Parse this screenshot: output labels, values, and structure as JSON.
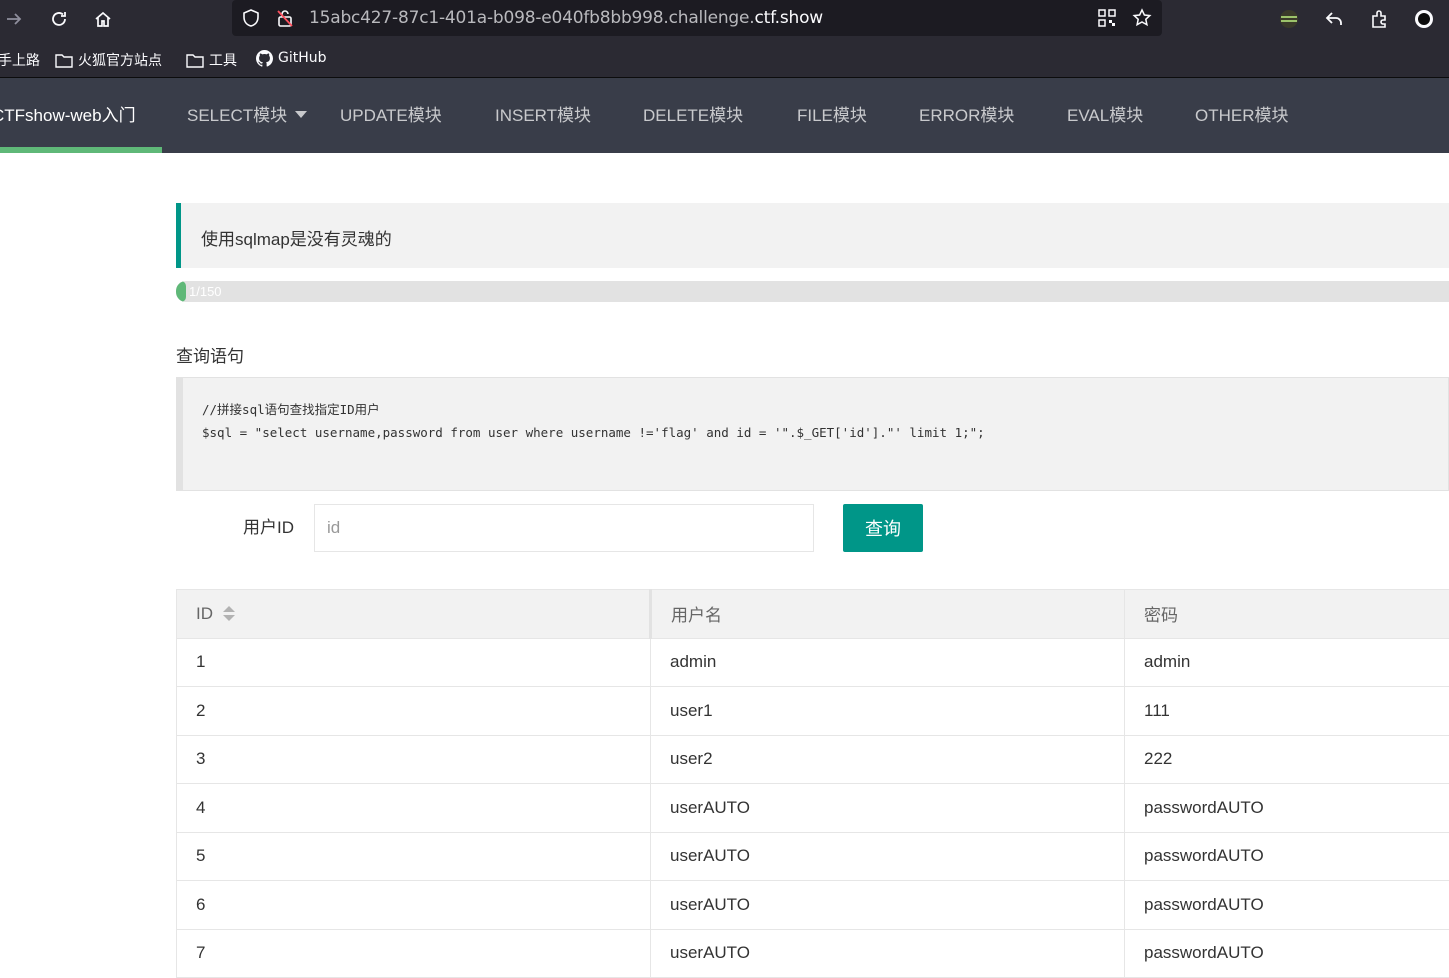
{
  "browser": {
    "url_prefix": "15abc427-87c1-401a-b098-e040fb8bb998.challenge.",
    "url_domain": "ctf.show",
    "bookmarks": [
      {
        "label": "手上路",
        "icon": "none"
      },
      {
        "label": "火狐官方站点",
        "icon": "folder-icon"
      },
      {
        "label": "工具",
        "icon": "folder-icon"
      },
      {
        "label": "GitHub",
        "icon": "github-icon"
      }
    ]
  },
  "nav": {
    "items": [
      {
        "label": "CTFshow-web入门",
        "active": true
      },
      {
        "label": "SELECT模块",
        "dropdown": true
      },
      {
        "label": "UPDATE模块"
      },
      {
        "label": "INSERT模块"
      },
      {
        "label": "DELETE模块"
      },
      {
        "label": "FILE模块"
      },
      {
        "label": "ERROR模块"
      },
      {
        "label": "EVAL模块"
      },
      {
        "label": "OTHER模块"
      }
    ],
    "active_color": "#5fb878"
  },
  "quote": "使用sqlmap是没有灵魂的",
  "progress": {
    "label": "1/150",
    "value": 1,
    "max": 150
  },
  "section_title": "查询语句",
  "code": {
    "line1": "//拼接sql语句查找指定ID用户",
    "line2": "$sql = \"select username,password from user where username !='flag' and id = '\".$_GET['id'].\"' limit 1;\";"
  },
  "form": {
    "label": "用户ID",
    "placeholder": "id",
    "value": "",
    "button": "查询"
  },
  "table": {
    "headers": [
      "ID",
      "用户名",
      "密码"
    ],
    "rows": [
      [
        "1",
        "admin",
        "admin"
      ],
      [
        "2",
        "user1",
        "111"
      ],
      [
        "3",
        "user2",
        "222"
      ],
      [
        "4",
        "userAUTO",
        "passwordAUTO"
      ],
      [
        "5",
        "userAUTO",
        "passwordAUTO"
      ],
      [
        "6",
        "userAUTO",
        "passwordAUTO"
      ],
      [
        "7",
        "userAUTO",
        "passwordAUTO"
      ]
    ]
  },
  "colors": {
    "accent": "#009688",
    "nav_bg": "#393d49",
    "progress": "#5fb878"
  }
}
